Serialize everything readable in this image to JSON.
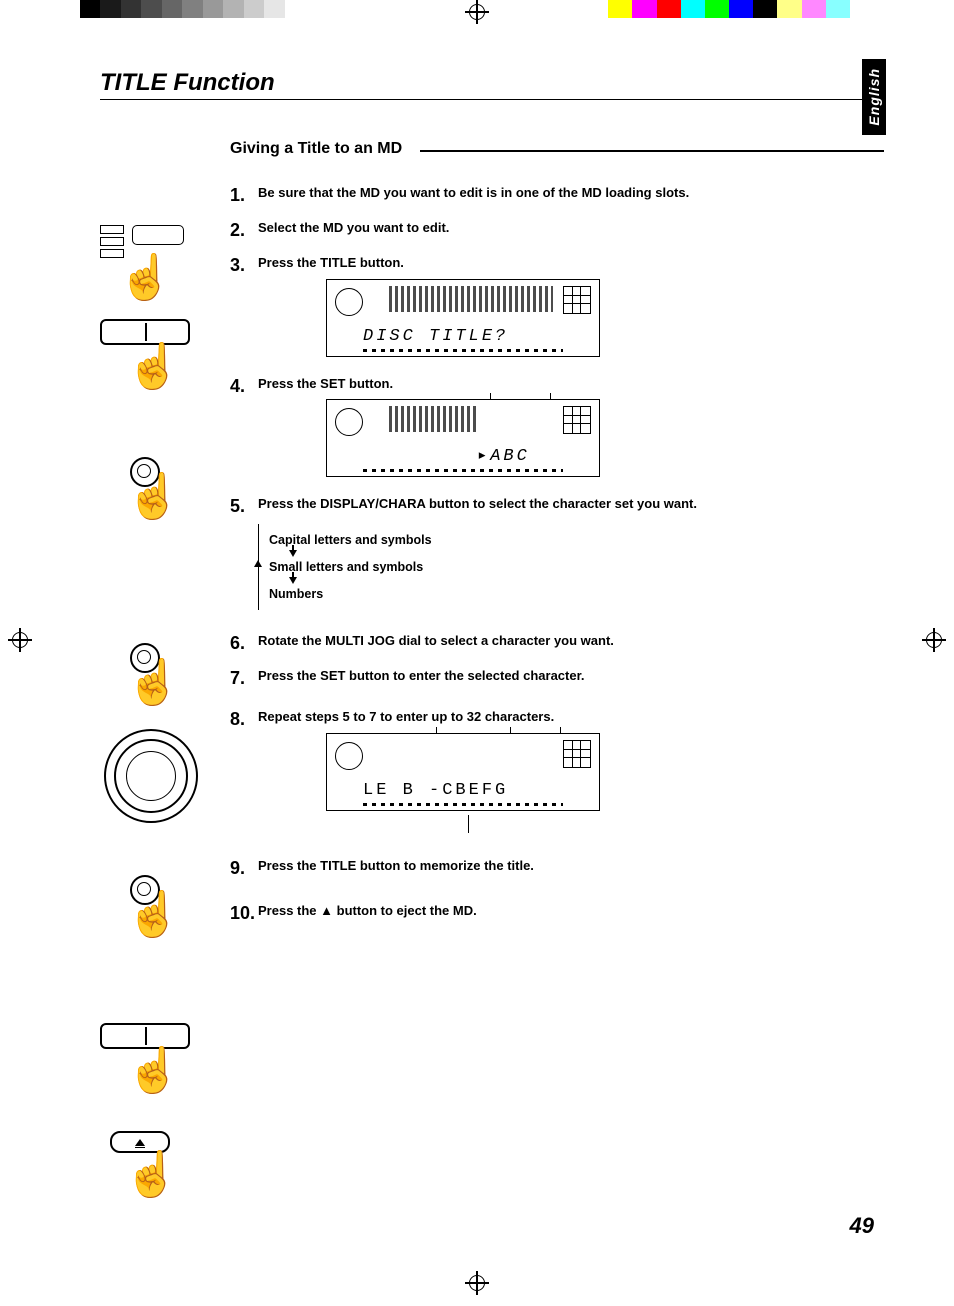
{
  "header": {
    "section_title": "TITLE Function",
    "language_tab": "English"
  },
  "subheading": "Giving a Title to an MD",
  "steps": [
    "Be sure that the MD you want to edit is in one of the MD loading slots.",
    "Select the MD you want to edit.",
    "Press the TITLE button.",
    "Press the SET button.",
    "Press the DISPLAY/CHARA button to select the character set you want.",
    "Rotate the MULTI JOG dial to select a character you want.",
    "Press the SET button to enter the selected character.",
    "Repeat steps 5 to 7 to enter up to 32 characters.",
    "Press the TITLE button to memorize the title.",
    "Press the ▲ button to eject the MD."
  ],
  "display_texts": {
    "panel1": "DISC TITLE?",
    "panel2": "  ▸ABC",
    "panel3": "LE B -CBEFG"
  },
  "char_sets": {
    "opt1": "Capital letters and symbols",
    "opt2": "Small letters and symbols",
    "opt3": "Numbers"
  },
  "page_number": "49",
  "printer_marks": {
    "grayscale_steps": [
      "#000",
      "#1a1a1a",
      "#333",
      "#4d4d4d",
      "#666",
      "#808080",
      "#999",
      "#b3b3b3",
      "#ccc",
      "#e6e6e6",
      "#fff"
    ],
    "color_steps": [
      "#fff",
      "#ff0",
      "#f0f",
      "#f00",
      "#0ff",
      "#0f0",
      "#00f",
      "#000",
      "#ff8",
      "#f8f",
      "#8ff",
      "#fff"
    ]
  }
}
